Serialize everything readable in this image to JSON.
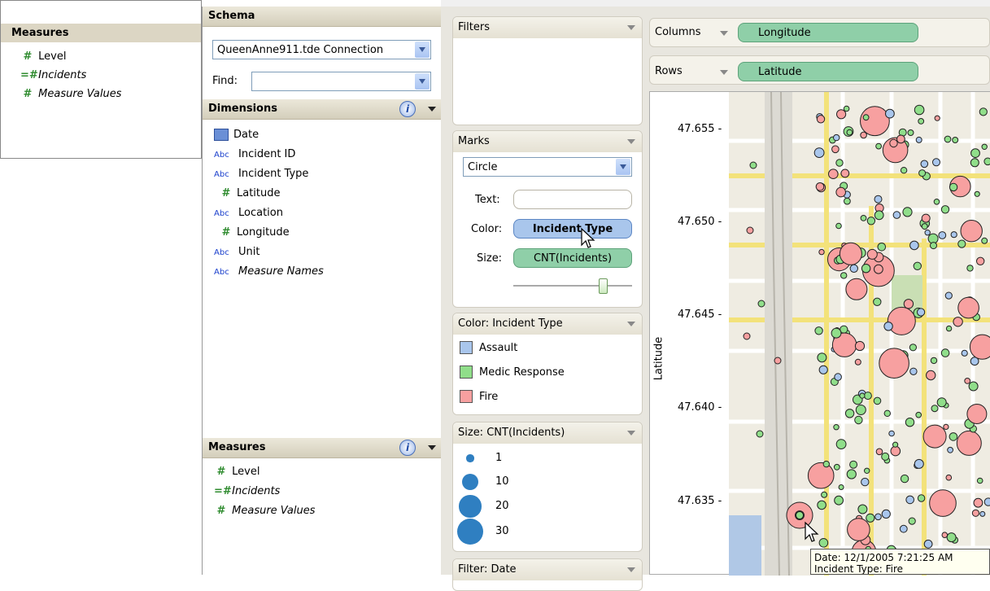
{
  "background_window": {
    "measures_title": "Measures",
    "items": [
      {
        "icon": "#",
        "label": "Level",
        "italic": false
      },
      {
        "icon": "=#",
        "label": "Incidents",
        "italic": true
      },
      {
        "icon": "#",
        "label": "Measure Values",
        "italic": true
      }
    ]
  },
  "schema": {
    "title": "Schema",
    "connection": "QueenAnne911.tde Connection",
    "find_label": "Find:",
    "find_value": "",
    "dimensions_title": "Dimensions",
    "dimensions": [
      {
        "icon": "date-icon",
        "label": "Date",
        "italic": false
      },
      {
        "icon": "Abc",
        "label": "Incident ID",
        "italic": false
      },
      {
        "icon": "Abc",
        "label": "Incident Type",
        "italic": false
      },
      {
        "icon": "#",
        "label": "Latitude",
        "italic": false
      },
      {
        "icon": "Abc",
        "label": "Location",
        "italic": false
      },
      {
        "icon": "#",
        "label": "Longitude",
        "italic": false
      },
      {
        "icon": "Abc",
        "label": "Unit",
        "italic": false
      },
      {
        "icon": "Abc",
        "label": "Measure Names",
        "italic": true
      }
    ],
    "measures_title": "Measures",
    "measures": [
      {
        "icon": "#",
        "label": "Level",
        "italic": false
      },
      {
        "icon": "=#",
        "label": "Incidents",
        "italic": true
      },
      {
        "icon": "#",
        "label": "Measure Values",
        "italic": true
      }
    ]
  },
  "filters": {
    "title": "Filters"
  },
  "marks": {
    "title": "Marks",
    "mark_type": "Circle",
    "text_label": "Text:",
    "color_label": "Color:",
    "color_field": "Incident Type",
    "size_label": "Size:",
    "size_field": "CNT(Incidents)",
    "size_slider_fraction": 0.75
  },
  "color_legend": {
    "title": "Color: Incident Type",
    "items": [
      {
        "label": "Assault",
        "color": "#a9c6ec"
      },
      {
        "label": "Medic Response",
        "color": "#90de8a"
      },
      {
        "label": "Fire",
        "color": "#f7a0a0"
      }
    ]
  },
  "size_legend": {
    "title": "Size: CNT(Incidents)",
    "items": [
      {
        "label": "1",
        "value": 1
      },
      {
        "label": "10",
        "value": 10
      },
      {
        "label": "20",
        "value": 20
      },
      {
        "label": "30",
        "value": 30
      }
    ]
  },
  "date_filter": {
    "title": "Filter: Date"
  },
  "shelves": {
    "columns_label": "Columns",
    "columns_field": "Longitude",
    "rows_label": "Rows",
    "rows_field": "Latitude"
  },
  "chart_data": {
    "type": "scatter",
    "title": "",
    "xlabel": "",
    "ylabel": "Latitude",
    "y_ticks": [
      "47.655",
      "47.650",
      "47.645",
      "47.640",
      "47.635"
    ],
    "ylim": [
      47.631,
      47.657
    ],
    "color_by": "Incident Type",
    "size_by": "CNT(Incidents)"
  },
  "tooltip": {
    "line1": "Date: 12/1/2005 7:21:25 AM",
    "line2": "Incident Type: Fire"
  },
  "colors": {
    "assault": "#a9c6ec",
    "medic": "#90de8a",
    "fire": "#f7a0a0",
    "size_legend": "#2f7fc1"
  }
}
